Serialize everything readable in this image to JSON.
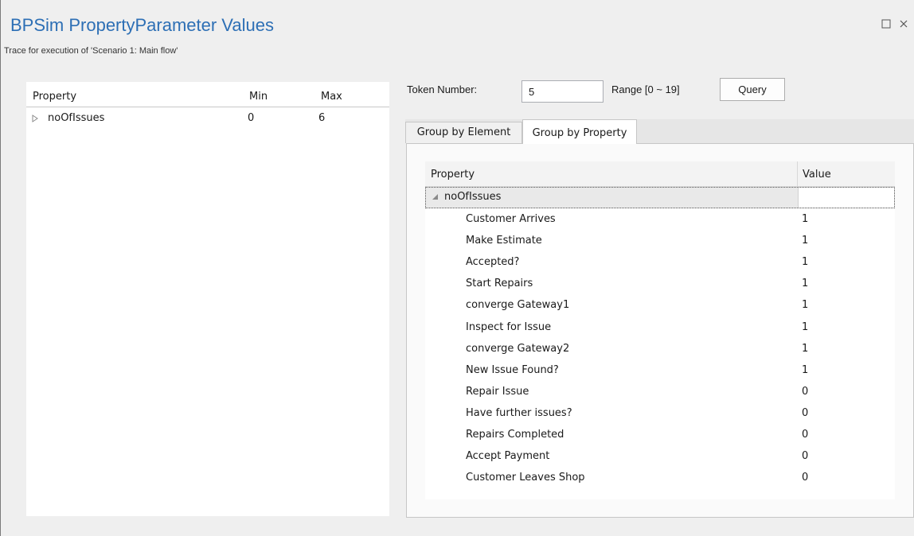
{
  "window": {
    "title": "BPSim PropertyParameter Values",
    "subtitle": "Trace for execution of 'Scenario 1: Main flow'",
    "maximize_icon": "maximize-icon",
    "close_icon": "close-icon"
  },
  "left_panel": {
    "columns": [
      "Property",
      "Min",
      "Max"
    ],
    "rows": [
      {
        "property": "noOfIssues",
        "min": "0",
        "max": "6",
        "expanded": false
      }
    ]
  },
  "query_bar": {
    "token_label": "Token Number:",
    "token_value": "5",
    "range_label": "Range [0 ~ 19]",
    "query_label": "Query"
  },
  "tabs": [
    {
      "label": "Group by Element",
      "active": false
    },
    {
      "label": "Group by Property",
      "active": true
    }
  ],
  "grid": {
    "columns": [
      "Property",
      "Value"
    ],
    "group": {
      "label": "noOfIssues",
      "expanded": true
    },
    "rows": [
      {
        "name": "Customer Arrives",
        "value": "1"
      },
      {
        "name": "Make Estimate",
        "value": "1"
      },
      {
        "name": "Accepted?",
        "value": "1"
      },
      {
        "name": "Start Repairs",
        "value": "1"
      },
      {
        "name": "converge Gateway1",
        "value": "1"
      },
      {
        "name": "Inspect for Issue",
        "value": "1"
      },
      {
        "name": "converge Gateway2",
        "value": "1"
      },
      {
        "name": "New Issue Found?",
        "value": "1"
      },
      {
        "name": "Repair Issue",
        "value": "0"
      },
      {
        "name": "Have further issues?",
        "value": "0"
      },
      {
        "name": "Repairs Completed",
        "value": "0"
      },
      {
        "name": "Accept Payment",
        "value": "0"
      },
      {
        "name": "Customer Leaves Shop",
        "value": "0"
      }
    ]
  },
  "colors": {
    "title": "#2d6fb5",
    "background": "#efefef",
    "panel": "#ffffff",
    "selection": "#e9e9e9"
  }
}
